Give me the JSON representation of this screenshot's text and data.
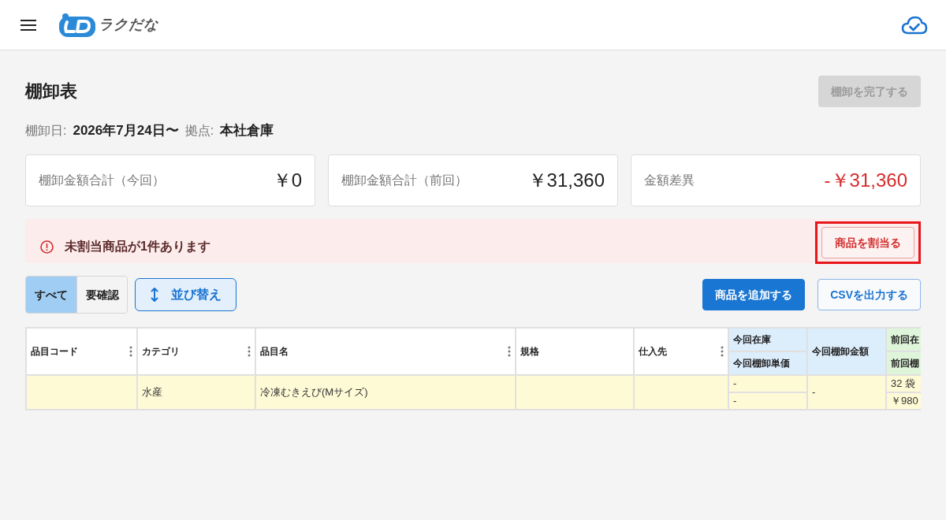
{
  "app_bar": {
    "logo_text": "ラクだな"
  },
  "page": {
    "title": "棚卸表",
    "complete_button": {
      "label": "棚卸を完了する",
      "disabled": true
    }
  },
  "info": [
    {
      "label": "棚卸日:",
      "value": "2026年7月24日〜"
    },
    {
      "label": "拠点:",
      "value": "本社倉庫"
    }
  ],
  "summary_cards": [
    {
      "label": "棚卸金額合計（今回）",
      "value": "￥0",
      "negative": false
    },
    {
      "label": "棚卸金額合計（前回）",
      "value": "￥31,360",
      "negative": false
    },
    {
      "label": "金額差異",
      "value": "-￥31,360",
      "negative": true
    }
  ],
  "alert": {
    "message": "未割当商品が1件あります",
    "action": {
      "label": "商品を割当る",
      "highlighted": true
    }
  },
  "filter_tabs": [
    {
      "label": "すべて",
      "selected": true
    },
    {
      "label": "要確認",
      "selected": false
    }
  ],
  "sort_button": {
    "label": "並び替え"
  },
  "actions": [
    {
      "label": "商品を追加する",
      "kind": "primary"
    },
    {
      "label": "CSVを出力する",
      "kind": "outline"
    }
  ],
  "table": {
    "columns": [
      {
        "label": "品目コード",
        "kind": "plain",
        "menu": true
      },
      {
        "label": "カテゴリ",
        "kind": "plain",
        "menu": true
      },
      {
        "label": "品目名",
        "kind": "plain",
        "menu": true
      },
      {
        "label": "規格",
        "kind": "plain",
        "menu": false
      },
      {
        "label": "仕入先",
        "kind": "plain",
        "menu": true
      },
      {
        "label": "今回在庫",
        "sub_label": "今回棚卸単価",
        "kind": "current",
        "menu": false
      },
      {
        "label": "今回棚卸金額",
        "kind": "current",
        "menu": false
      },
      {
        "label": "前回在",
        "sub_label": "前回棚",
        "kind": "previous",
        "menu": false
      }
    ],
    "rows": [
      {
        "highlighted": true,
        "category": "水産",
        "item_name": "冷凍むきえび(Mサイズ)",
        "current_stock": "-",
        "current_unit_price": "-",
        "current_amount": "-",
        "column_8_top": "32 袋",
        "column_8_bottom": "￥980"
      }
    ]
  }
}
